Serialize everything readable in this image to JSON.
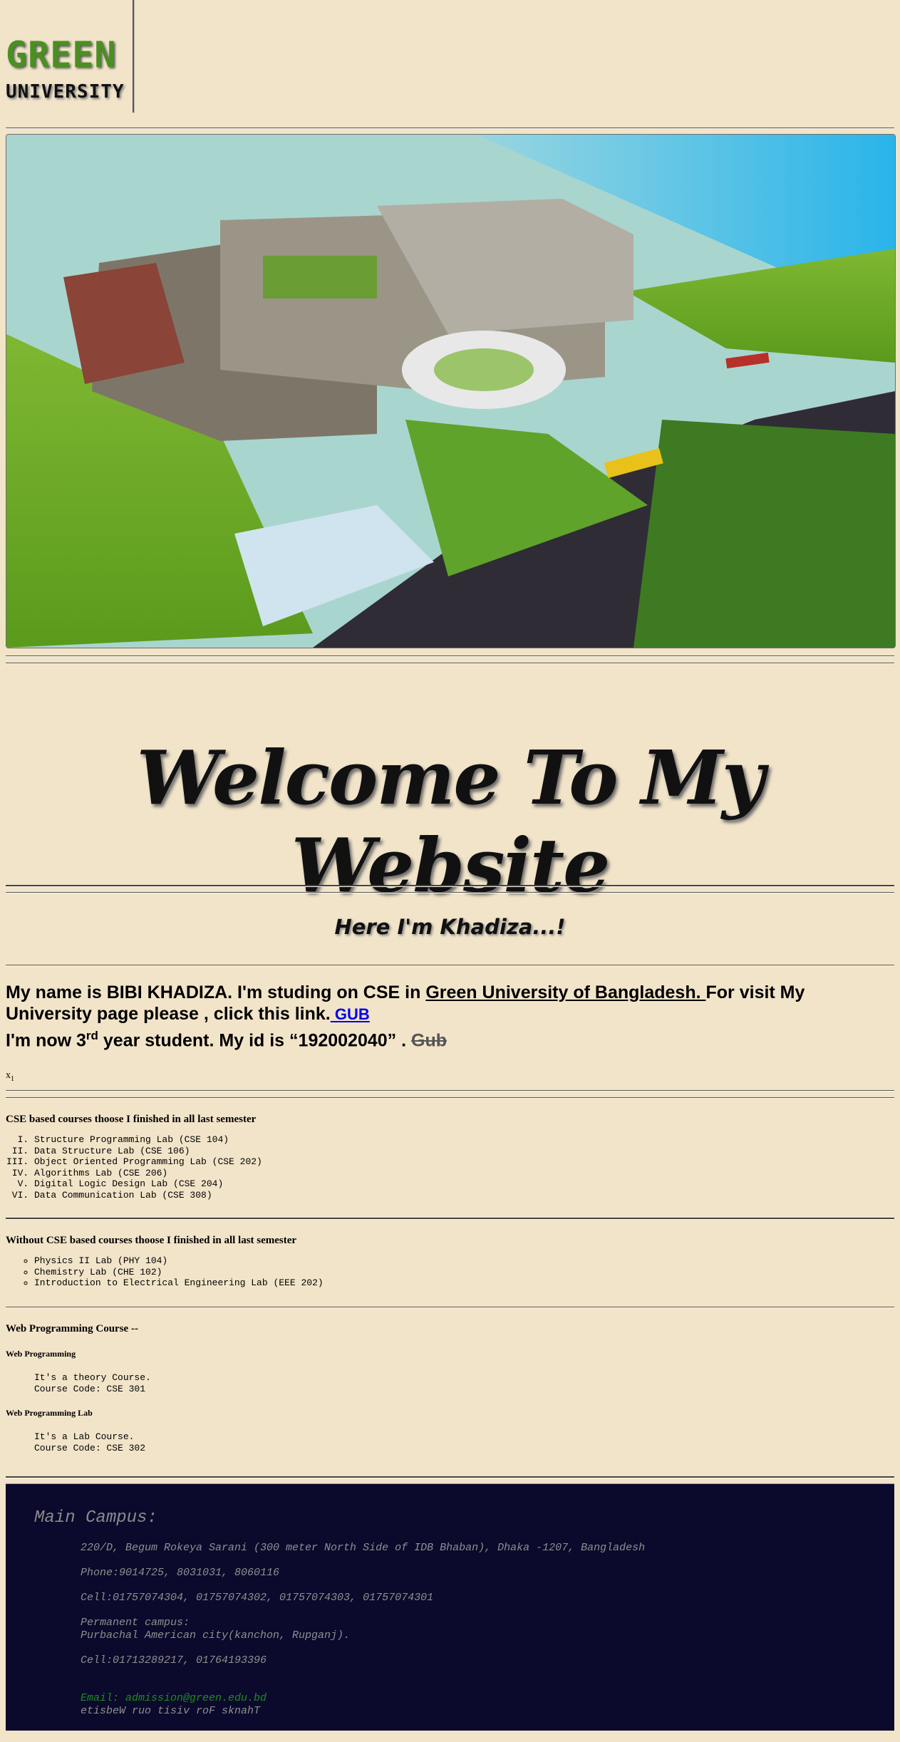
{
  "logo": {
    "line1": "GREEN",
    "line2": "UNIVERSITY"
  },
  "hero": {
    "alt": "Green University campus aerial rendering"
  },
  "welcome": "Welcome To My Website",
  "greeting": "Here I'm Khadiza...!",
  "intro": {
    "part1": "My name is BIBI KHADIZA. I'm studing on CSE in ",
    "university_link": "Green University of Bangladesh. ",
    "part2": "For visit My University page please , click this link.",
    "gub_link": " GUB",
    "part3": "I'm now 3",
    "sup": "rd",
    "part4": " year student. My id is “192002040” . ",
    "strike": "Gub"
  },
  "x_sub": {
    "base": "x",
    "sub": "1"
  },
  "cse_courses": {
    "heading": "CSE based courses thoose I finished in all last semester",
    "items": [
      "Structure Programming Lab (CSE 104)",
      "Data Structure Lab (CSE 106)",
      "Object Oriented Programming Lab (CSE 202)",
      "Algorithms Lab (CSE 206)",
      "Digital Logic Design Lab (CSE 204)",
      "Data Communication Lab (CSE 308)"
    ]
  },
  "other_courses": {
    "heading": "Without CSE based courses thoose I finished in all last semester",
    "items": [
      "Physics II Lab (PHY 104)",
      "Chemistry Lab (CHE 102)",
      "Introduction to Electrical Engineering Lab (EEE 202)"
    ]
  },
  "web_course": {
    "heading": "Web Programming Course --",
    "theory_title": "Web Programming",
    "theory_line1": "It's a theory Course.",
    "theory_line2": "Course Code: CSE 301",
    "lab_title": "Web Programming Lab",
    "lab_line1": "It's a Lab Course.",
    "lab_line2": "Course Code: CSE 302"
  },
  "footer": {
    "title": "Main Campus:",
    "address": "220/D, Begum Rokeya Sarani (300 meter North Side of IDB Bhaban), Dhaka -1207, Bangladesh",
    "phone": "Phone:9014725, 8031031, 8060116",
    "cell": "Cell:01757074304, 01757074302, 01757074303, 01757074301",
    "perm_label": "Permanent campus:",
    "perm_addr": "Purbachal American city(kanchon, Rupganj).",
    "perm_cell": "Cell:01713289217, 01764193396",
    "email": "Email: admission@green.edu.bd",
    "reversed": "etisbeW ruo tisiv roF sknahT"
  },
  "colors": {
    "background": "#f2e4c9",
    "logo_green": "#4a8f22",
    "footer_bg": "#0b0a2c",
    "link": "#0000ee"
  }
}
